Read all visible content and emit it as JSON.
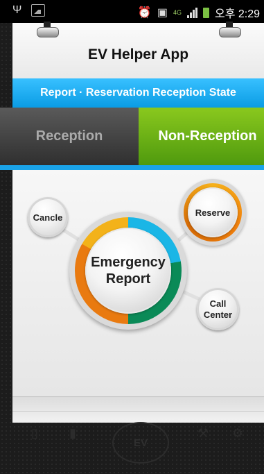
{
  "status_bar": {
    "icons": [
      "usb-icon",
      "gallery-icon",
      "alarm-icon",
      "wifi-direct-icon",
      "lte-icon",
      "signal-icon",
      "battery-icon"
    ],
    "network_label": "4G",
    "time": "오후 2:29"
  },
  "app": {
    "title": "EV Helper App",
    "subtitle": "Report · Reservation Reception State"
  },
  "tabs": [
    {
      "label": "Reception",
      "active": false
    },
    {
      "label": "Non-Reception",
      "active": true
    }
  ],
  "actions": {
    "cancel": "Cancle",
    "reserve": "Reserve",
    "emergency_line1": "Emergency",
    "emergency_line2": "Report",
    "call_line1": "Call",
    "call_line2": "Center"
  },
  "footer": {
    "center_badge": "EV"
  },
  "colors": {
    "accent_blue": "#1aa3e8",
    "accent_green": "#6cb318",
    "orange": "#f07f0c"
  }
}
